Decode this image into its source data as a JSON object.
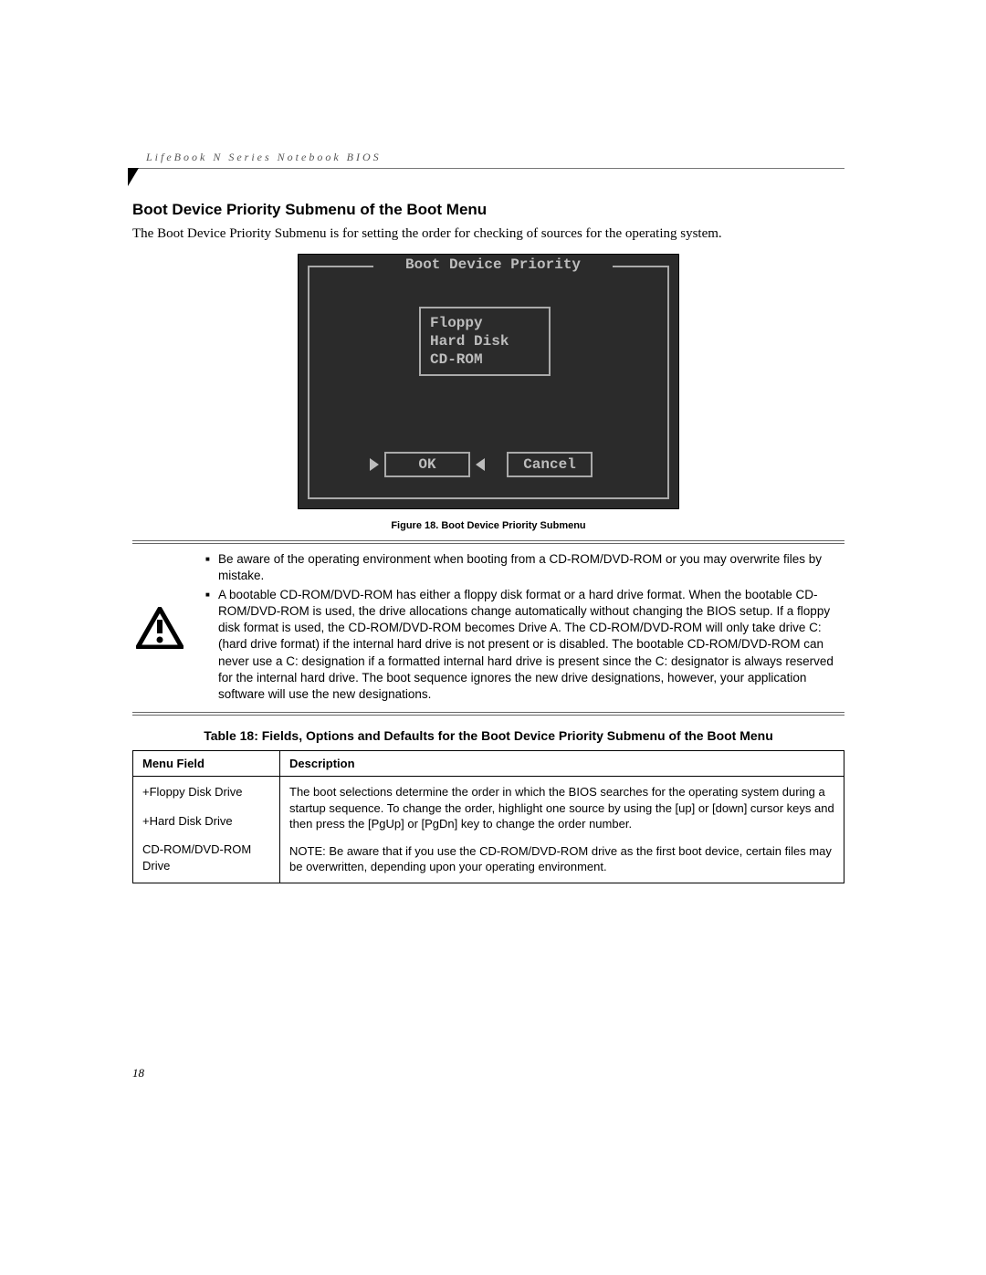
{
  "header": {
    "running": "LifeBook N Series Notebook BIOS"
  },
  "section": {
    "title": "Boot Device Priority Submenu of the Boot Menu",
    "intro": "The Boot Device Priority Submenu is for setting the order for checking of sources for the operating system."
  },
  "bios": {
    "frame_title": "Boot Device Priority",
    "devices": [
      "Floppy",
      "Hard Disk",
      "CD-ROM"
    ],
    "ok_label": "OK",
    "cancel_label": "Cancel"
  },
  "figure_caption": "Figure 18.  Boot Device Priority Submenu",
  "callout": {
    "items": [
      "Be aware of the operating environment when booting from a CD-ROM/DVD-ROM or you may overwrite files by mistake.",
      "A bootable CD-ROM/DVD-ROM has either a floppy disk format or a hard drive format. When the bootable CD-ROM/DVD-ROM is used, the drive allocations change automatically without changing the BIOS setup. If a floppy disk format is used, the CD-ROM/DVD-ROM becomes Drive A. The CD-ROM/DVD-ROM will only take drive C: (hard drive format) if the internal hard drive is not present or is disabled. The bootable CD-ROM/DVD-ROM can never use a C: designation if a formatted internal hard drive is present since the C: designator is always reserved for the internal hard drive. The boot sequence ignores the new drive designations, however, your application software will use the new designations."
    ]
  },
  "table": {
    "title": "Table 18: Fields, Options and Defaults for the Boot Device Priority Submenu of the Boot Menu",
    "headers": {
      "field": "Menu Field",
      "desc": "Description"
    },
    "fields": [
      "+Floppy Disk Drive",
      "+Hard Disk Drive",
      " CD-ROM/DVD-ROM Drive"
    ],
    "description": [
      "The boot selections determine the order in which the BIOS searches for the operating system during a startup sequence. To change the order, highlight one source by using the [up] or [down] cursor keys and then press the [PgUp] or [PgDn] key to change the order number.",
      "NOTE: Be aware that if you use the CD-ROM/DVD-ROM drive as the first boot device, certain files may be overwritten, depending upon your operating environment."
    ]
  },
  "page_number": "18"
}
